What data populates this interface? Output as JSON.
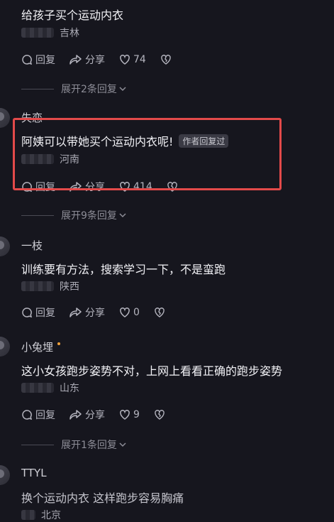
{
  "comments": [
    {
      "username": "",
      "text": "给孩子买个运动内衣",
      "location": "吉林",
      "reply_label": "回复",
      "share_label": "分享",
      "likes": "74"
    },
    {
      "username": "失恋",
      "text": "阿姨可以带她买个运动内衣呢!",
      "author_badge": "作者回复过",
      "location": "河南",
      "reply_label": "回复",
      "share_label": "分享",
      "likes": "414"
    },
    {
      "username": "一枝",
      "text": "训练要有方法，搜索学习一下，不是蛮跑",
      "location": "陕西",
      "reply_label": "回复",
      "share_label": "分享",
      "likes": "0"
    },
    {
      "username": "小兔埋",
      "text": "这小女孩跑步姿势不对，上网上看看正确的跑步姿势",
      "location": "山东",
      "reply_label": "回复",
      "share_label": "分享",
      "likes": "9"
    },
    {
      "username": "TTYL",
      "text": "换个运动内衣 这样跑步容易胸痛",
      "location": "北京"
    }
  ],
  "expand_replies": [
    "展开2条回复",
    "展开9条回复",
    "展开1条回复"
  ],
  "colors": {
    "background": "#16161e",
    "highlight_border": "#e34a4a"
  }
}
